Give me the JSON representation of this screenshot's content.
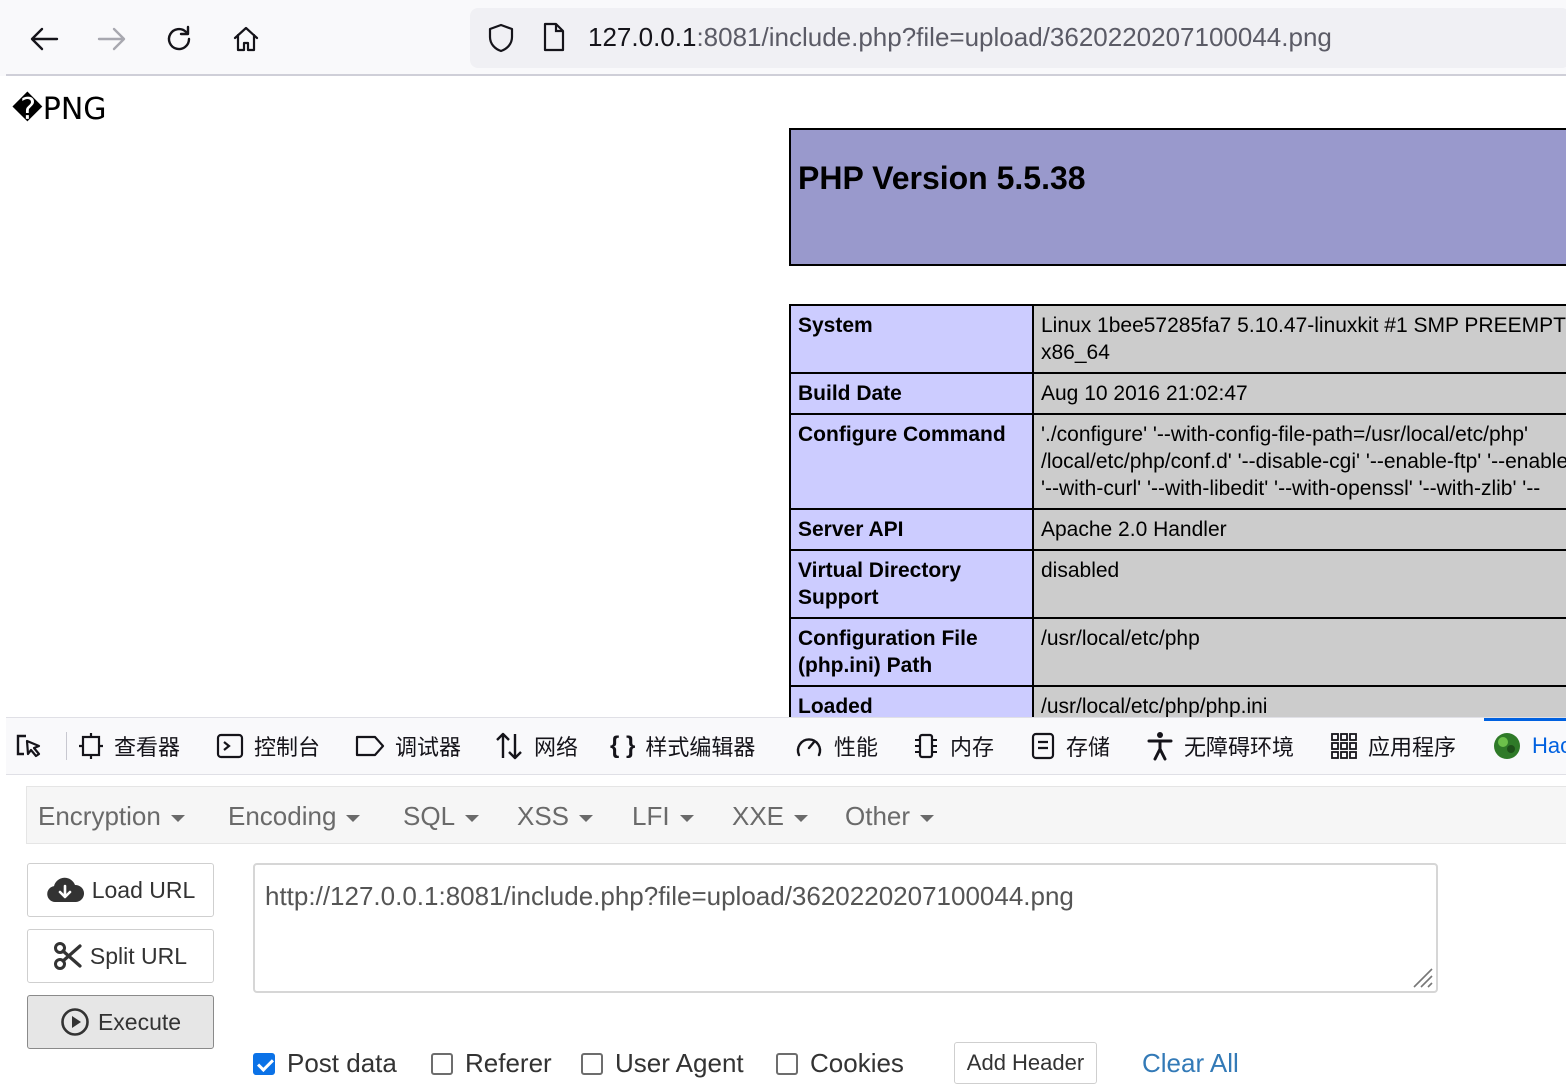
{
  "browser": {
    "url_host": "127.0.0.1",
    "url_rest": ":8081/include.php?file=upload/3620220207100044.png"
  },
  "page": {
    "png_marker": "�PNG",
    "php_version_title": "PHP Version 5.5.38",
    "info_rows": [
      {
        "label": "System",
        "value": "Linux 1bee57285fa7 5.10.47-linuxkit #1 SMP PREEMPT\nx86_64"
      },
      {
        "label": "Build Date",
        "value": "Aug 10 2016 21:02:47"
      },
      {
        "label": "Configure Command",
        "value": "'./configure' '--with-config-file-path=/usr/local/etc/php'\n/local/etc/php/conf.d' '--disable-cgi' '--enable-ftp' '--enable\n'--with-curl' '--with-libedit' '--with-openssl' '--with-zlib' '--"
      },
      {
        "label": "Server API",
        "value": "Apache 2.0 Handler"
      },
      {
        "label": "Virtual Directory Support",
        "value": "disabled"
      },
      {
        "label": "Configuration File (php.ini) Path",
        "value": "/usr/local/etc/php"
      },
      {
        "label": "Loaded",
        "value": "/usr/local/etc/php/php.ini"
      }
    ]
  },
  "devtools": {
    "tabs": {
      "inspector": "查看器",
      "console": "控制台",
      "debugger": "调试器",
      "network": "网络",
      "style_editor": "样式编辑器",
      "performance": "性能",
      "memory": "内存",
      "storage": "存储",
      "accessibility": "无障碍环境",
      "application": "应用程序",
      "hackbar": "Hac"
    },
    "accent_color": "#0061e0"
  },
  "hackbar": {
    "menu": {
      "encryption": "Encryption",
      "encoding": "Encoding",
      "sql": "SQL",
      "xss": "XSS",
      "lfi": "LFI",
      "xxe": "XXE",
      "other": "Other"
    },
    "buttons": {
      "load_url": "Load URL",
      "split_url": "Split URL",
      "execute": "Execute"
    },
    "url_value": "http://127.0.0.1:8081/include.php?file=upload/3620220207100044.png",
    "options": {
      "post_data": {
        "label": "Post data",
        "checked": true
      },
      "referer": {
        "label": "Referer",
        "checked": false
      },
      "user_agent": {
        "label": "User Agent",
        "checked": false
      },
      "cookies": {
        "label": "Cookies",
        "checked": false
      }
    },
    "add_header": "Add Header",
    "clear_all": "Clear All"
  }
}
